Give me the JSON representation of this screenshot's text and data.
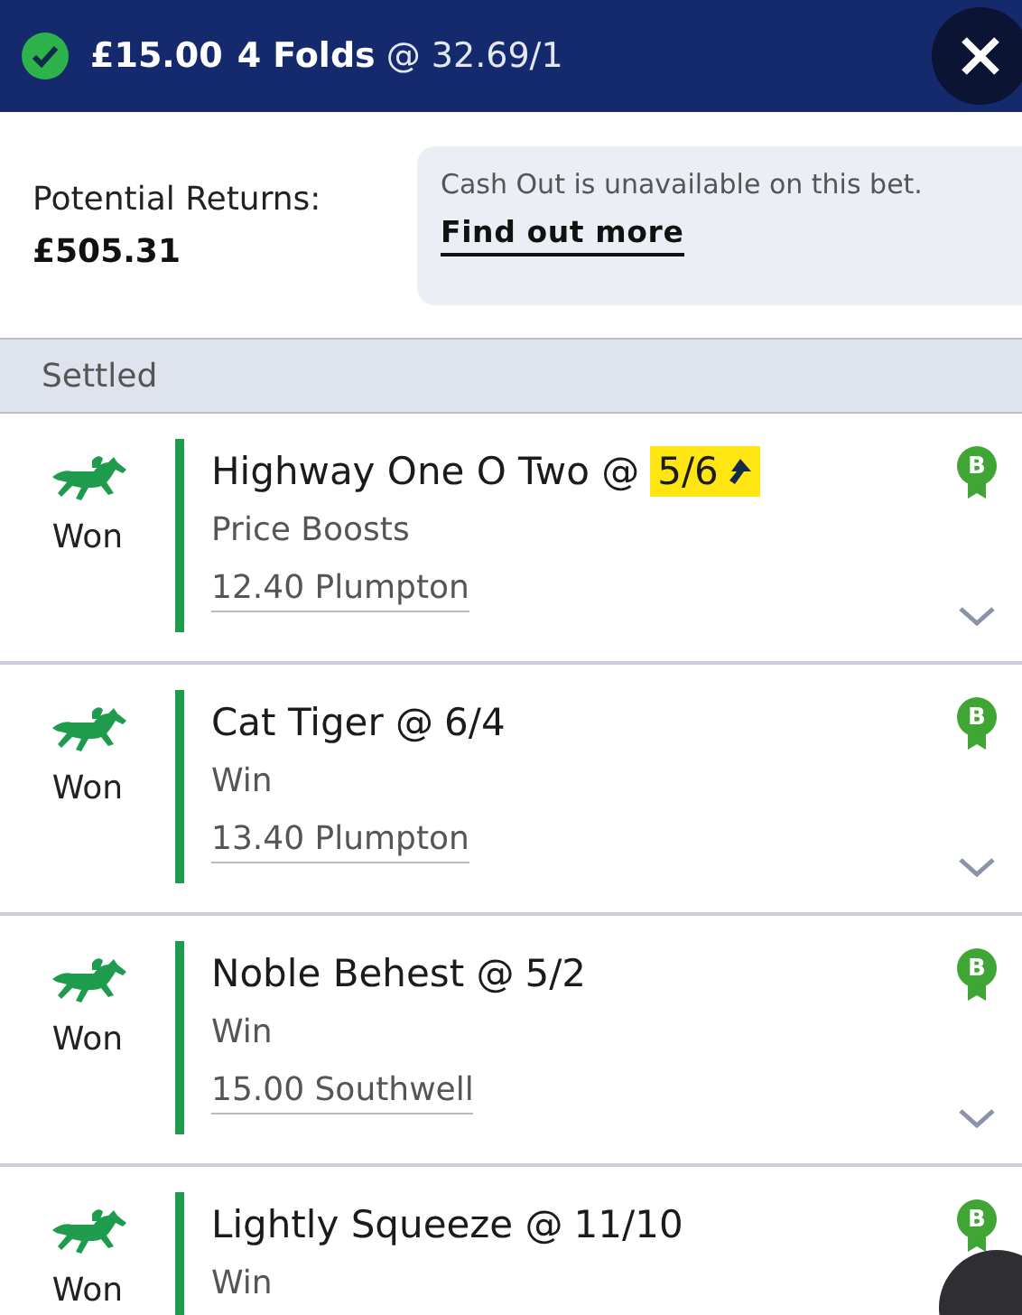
{
  "header": {
    "stake": "£15.00",
    "bet_type": "4 Folds",
    "odds": "@ 32.69/1",
    "settled_ok": true
  },
  "returns": {
    "label": "Potential Returns:",
    "value": "£505.31"
  },
  "cashout": {
    "message": "Cash Out is unavailable on this bet.",
    "link": "Find out more"
  },
  "section": "Settled",
  "legs": [
    {
      "result": "Won",
      "selection": "Highway One O Two @",
      "price": "5/6",
      "boosted": true,
      "market": "Price Boosts",
      "race": "12.40 Plumpton",
      "badge": "B"
    },
    {
      "result": "Won",
      "selection": "Cat Tiger @",
      "price": "6/4",
      "boosted": false,
      "market": "Win",
      "race": "13.40 Plumpton",
      "badge": "B"
    },
    {
      "result": "Won",
      "selection": "Noble Behest @",
      "price": "5/2",
      "boosted": false,
      "market": "Win",
      "race": "15.00 Southwell",
      "badge": "B"
    },
    {
      "result": "Won",
      "selection": "Lightly Squeeze @",
      "price": "11/10",
      "boosted": false,
      "market": "Win",
      "badge": "B"
    }
  ]
}
